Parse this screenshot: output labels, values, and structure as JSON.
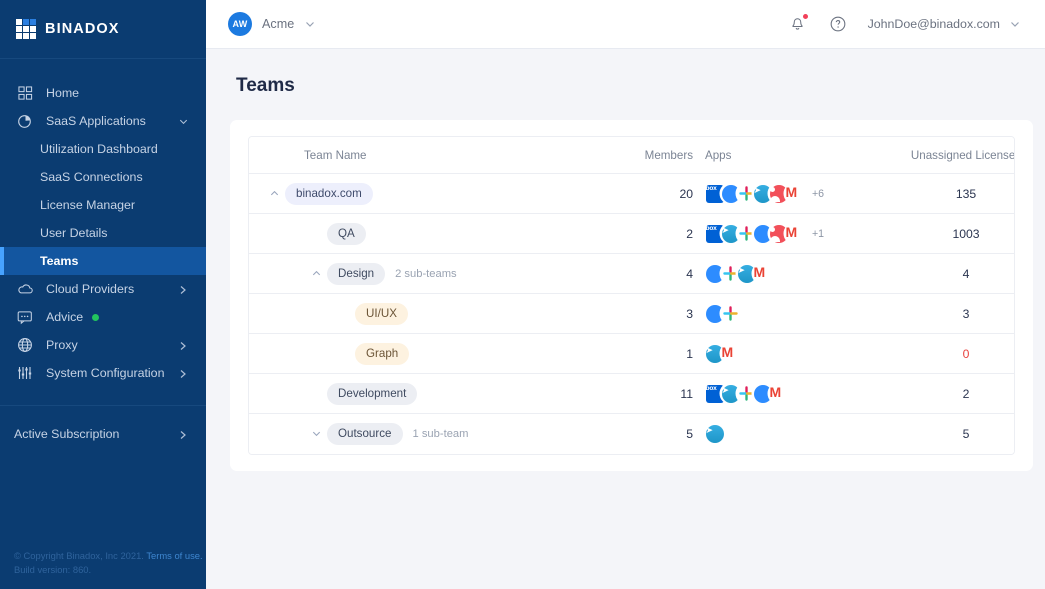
{
  "brand": {
    "name": "BINADOX",
    "logo_icon": "grid-logo-icon",
    "sidebar_bg": "#0b3c71",
    "accent": "#47a3ff"
  },
  "sidebar": {
    "items": [
      {
        "label": "Home",
        "icon": "grid-icon",
        "level": 0,
        "chevron": "",
        "active": false
      },
      {
        "label": "SaaS Applications",
        "icon": "pie-chart-icon",
        "level": 0,
        "chevron": "down",
        "active": false
      },
      {
        "label": "Utilization Dashboard",
        "icon": "",
        "level": 1,
        "chevron": "",
        "active": false
      },
      {
        "label": "SaaS Connections",
        "icon": "",
        "level": 1,
        "chevron": "",
        "active": false
      },
      {
        "label": "License Manager",
        "icon": "",
        "level": 1,
        "chevron": "",
        "active": false
      },
      {
        "label": "User Details",
        "icon": "",
        "level": 1,
        "chevron": "",
        "active": false
      },
      {
        "label": "Teams",
        "icon": "",
        "level": 1,
        "chevron": "",
        "active": true
      },
      {
        "label": "Cloud Providers",
        "icon": "cloud-icon",
        "level": 0,
        "chevron": "right",
        "active": false
      },
      {
        "label": "Advice",
        "icon": "chat-bubble-icon",
        "level": 0,
        "chevron": "",
        "active": false,
        "status_dot": "#22c55e"
      },
      {
        "label": "Proxy",
        "icon": "globe-icon",
        "level": 0,
        "chevron": "right",
        "active": false
      },
      {
        "label": "System Configuration",
        "icon": "sliders-icon",
        "level": 0,
        "chevron": "right",
        "active": false
      }
    ],
    "subscription": {
      "label": "Active Subscription",
      "chevron": "right"
    },
    "footer": {
      "copyright": "© Copyright Binadox, Inc 2021.",
      "terms_link": "Terms of use.",
      "build": "Build version: 860."
    }
  },
  "topbar": {
    "org": {
      "initials": "AW",
      "name": "Acme",
      "chevron_icon": "chevron-down-icon"
    },
    "notifications_icon": "bell-icon",
    "help_icon": "question-circle-icon",
    "user": {
      "email": "JohnDoe@binadox.com",
      "chevron_icon": "chevron-down-icon"
    }
  },
  "page": {
    "title": "Teams"
  },
  "table": {
    "columns": [
      "Team Name",
      "Members",
      "Apps",
      "Unassigned Licenses"
    ],
    "rows": [
      {
        "name": "binadox.com",
        "pill": "lav",
        "indent": 0,
        "expander": "up",
        "sub_info": "",
        "members": "20",
        "apps": [
          "box",
          "zoom",
          "slack",
          "telegram",
          "person",
          "gmail"
        ],
        "apps_more": "+6",
        "licenses": "135",
        "licenses_danger": false
      },
      {
        "name": "QA",
        "pill": "gray",
        "indent": 1,
        "expander": "",
        "sub_info": "",
        "members": "2",
        "apps": [
          "box",
          "telegram",
          "slack",
          "zoom",
          "person",
          "gmail"
        ],
        "apps_more": "+1",
        "licenses": "1003",
        "licenses_danger": false
      },
      {
        "name": "Design",
        "pill": "gray",
        "indent": 1,
        "expander": "up",
        "sub_info": "2 sub-teams",
        "members": "4",
        "apps": [
          "zoom",
          "slack",
          "telegram",
          "gmail"
        ],
        "apps_more": "",
        "licenses": "4",
        "licenses_danger": false
      },
      {
        "name": "UI/UX",
        "pill": "cream",
        "indent": 2,
        "expander": "",
        "sub_info": "",
        "members": "3",
        "apps": [
          "zoom",
          "slack"
        ],
        "apps_more": "",
        "licenses": "3",
        "licenses_danger": false
      },
      {
        "name": "Graph",
        "pill": "cream",
        "indent": 2,
        "expander": "",
        "sub_info": "",
        "members": "1",
        "apps": [
          "telegram",
          "gmail"
        ],
        "apps_more": "",
        "licenses": "0",
        "licenses_danger": true
      },
      {
        "name": "Development",
        "pill": "gray",
        "indent": 1,
        "expander": "",
        "sub_info": "",
        "members": "11",
        "apps": [
          "box",
          "telegram",
          "slack",
          "zoom",
          "gmail"
        ],
        "apps_more": "",
        "licenses": "2",
        "licenses_danger": false
      },
      {
        "name": "Outsource",
        "pill": "gray",
        "indent": 1,
        "expander": "down",
        "sub_info": "1 sub-team",
        "members": "5",
        "apps": [
          "telegram"
        ],
        "apps_more": "",
        "licenses": "5",
        "licenses_danger": false
      }
    ]
  }
}
